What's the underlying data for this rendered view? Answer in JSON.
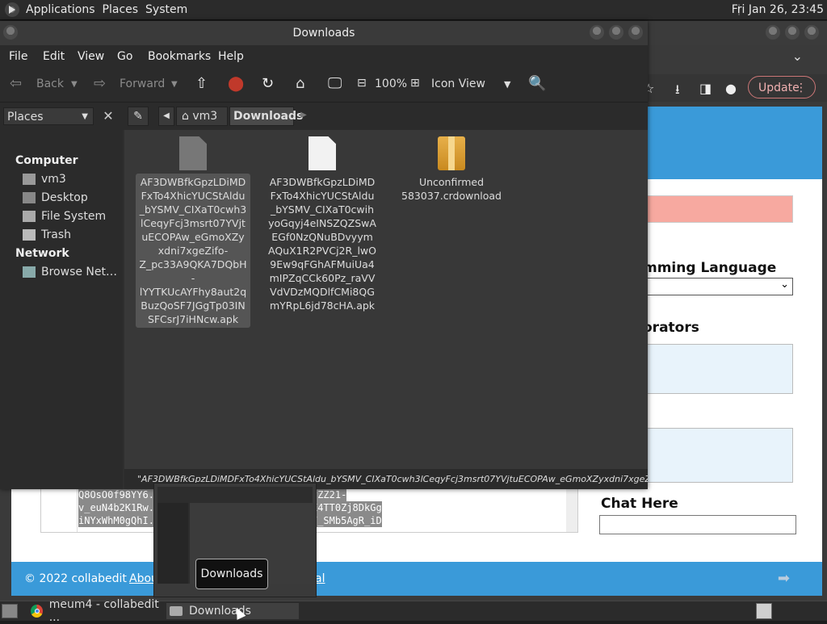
{
  "top_panel": {
    "menus": [
      "Applications",
      "Places",
      "System"
    ],
    "clock": "Fri Jan 26, 23:45"
  },
  "browser": {
    "update_label": "Update",
    "labels": {
      "programming_language": "mming Language",
      "collaborators": "orators",
      "chat_here": "Chat Here"
    },
    "select_value": "xt",
    "editor_lines": [
      "Q8OsO0f98YY6...nFM6ObRzzHvTyT0k_abx_h1QTfZZ21-",
      "v_euN4b2K1Rw...bBN24qfh_pTmRoggMzBMtcIwJE4TT0Zj8DkGg",
      "iNYxWhM0gQhI...E1_Nf7qM0rnWUE9Gz5XAYpEYw7_SMb5AgR_iD"
    ],
    "footer": {
      "copyright": "© 2022 collabedit",
      "about": "Abou",
      "al": "al"
    }
  },
  "file_manager": {
    "title": "Downloads",
    "menu": [
      "File",
      "Edit",
      "View",
      "Go",
      "Bookmarks",
      "Help"
    ],
    "toolbar": {
      "back": "Back",
      "forward": "Forward",
      "zoom": "100%",
      "view_mode": "Icon View"
    },
    "sidebar_header": "Places",
    "sidebar": {
      "sections": [
        {
          "title": "Computer",
          "items": [
            "vm3",
            "Desktop",
            "File System",
            "Trash"
          ]
        },
        {
          "title": "Network",
          "items": [
            "Browse Net…"
          ]
        }
      ]
    },
    "location": [
      "vm3",
      "Downloads"
    ],
    "files": [
      {
        "name": "AF3DWBfkGpzLDiMDFxTo4XhicYUCStAldu_bYSMV_CIXaT0cwh3lCeqyFcj3msrt07YVjtuECOPAw_eGmoXZyxdni7xgeZifo-Z_pc33A9QKA7DQbH-lYYTKUcAYFhy8aut2qBuzQoSF7JGgTp03INSFCsrJ7iHNcw.apk",
        "icon": "doc-gray",
        "selected": true
      },
      {
        "name": "AF3DWBfkGpzLDiMDFxTo4XhicYUCStAldu_bYSMV_CIXaT0cwihyoGqyj4eINSZQZSwAEGf0NzQNuBDvyymAQuX1R2PVCj2R_lwO9Ew9qFGhAFMuiUa4mIPZqCCk60Pz_raVVVdVDzMQDlfCMi8QGmYRpL6jd78cHA.apk",
        "icon": "doc-white",
        "selected": false
      },
      {
        "name": "Unconfirmed 583037.crdownload",
        "icon": "package",
        "selected": false
      }
    ],
    "status": "\"AF3DWBfkGpzLDiMDFxTo4XhicYUCStAldu_bYSMV_CIXaT0cwh3lCeqyFcj3msrt07YVjtuECOPAw_eGmoXZyxdni7xgeZifo-..."
  },
  "tooltip": "Downloads",
  "taskbar": {
    "tasks": [
      "meum4 - collabedit ...",
      "Downloads"
    ]
  }
}
